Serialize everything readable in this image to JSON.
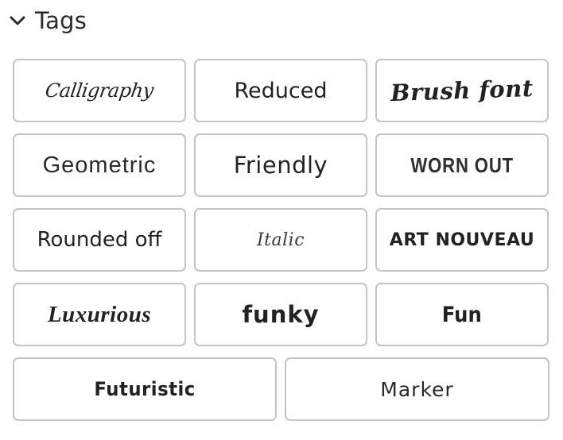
{
  "section": {
    "title": "Tags",
    "expanded": true,
    "toggle_icon": "chevron-down-icon"
  },
  "tags": [
    {
      "label": "Calligraphy"
    },
    {
      "label": "Reduced"
    },
    {
      "label": "Brush font"
    },
    {
      "label": "Geometric"
    },
    {
      "label": "Friendly"
    },
    {
      "label": "WORN OUT"
    },
    {
      "label": "Rounded off"
    },
    {
      "label": "Italic"
    },
    {
      "label": "ART NOUVEAU"
    },
    {
      "label": "Luxurious"
    },
    {
      "label": "funky"
    },
    {
      "label": "Fun"
    },
    {
      "label": "Futuristic"
    },
    {
      "label": "Marker"
    }
  ],
  "colors": {
    "tag_border": "#c4c4c4",
    "text": "#222222"
  }
}
